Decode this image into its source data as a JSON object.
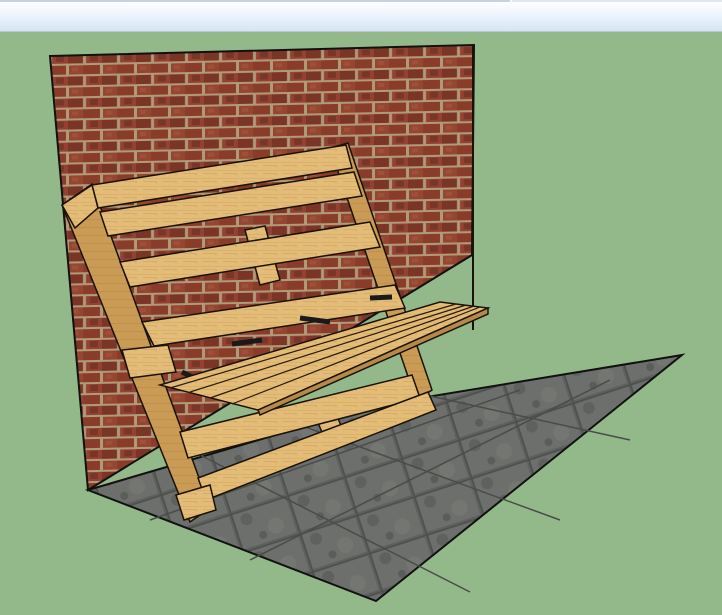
{
  "window": {
    "toolbar": {
      "label": ""
    }
  },
  "viewport": {
    "background_color": "#93b98a",
    "scene": {
      "objects": [
        "brick-wall",
        "paving-floor",
        "pallet-bench-back",
        "pallet-bench-seat",
        "metal-support-bars"
      ]
    }
  },
  "colors": {
    "brick": "#8a3f2c",
    "mortar": "#b9a27e",
    "wood": "#e0b872",
    "floor": "#6a6d6a",
    "edge": "#1a1208"
  }
}
